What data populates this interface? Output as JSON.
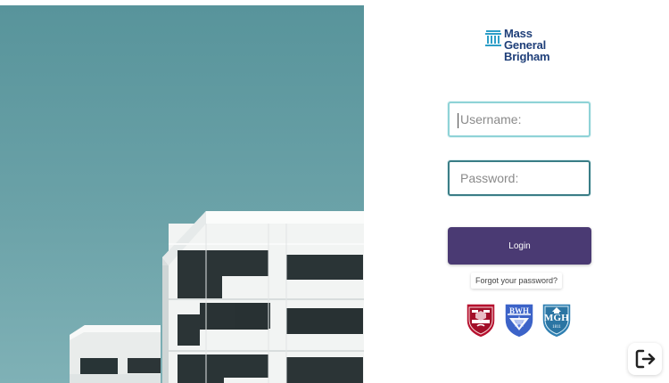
{
  "brand": {
    "line1": "Mass",
    "line2": "General",
    "line3": "Brigham",
    "icon": "pillar-icon",
    "color": "#1f3f79"
  },
  "form": {
    "username": {
      "placeholder": "Username:",
      "value": ""
    },
    "password": {
      "placeholder": "Password:",
      "value": ""
    },
    "login_label": "Login",
    "forgot_label": "Forgot your password?"
  },
  "affiliates": [
    {
      "name": "Harvard Medical School",
      "icon": "harvard-shield-icon"
    },
    {
      "name": "Brigham and Women's Hospital",
      "icon": "bwh-shield-icon",
      "label": "BWH"
    },
    {
      "name": "Massachusetts General Hospital",
      "icon": "mgh-shield-icon",
      "label": "MGH",
      "year": "1811"
    }
  ],
  "footer": {
    "exit_icon": "sign-out-icon"
  },
  "colors": {
    "accent": "#4a3a73",
    "username_border": "#8fd3d7",
    "password_border": "#3a7d86",
    "hero_sky": "#5f969d"
  }
}
